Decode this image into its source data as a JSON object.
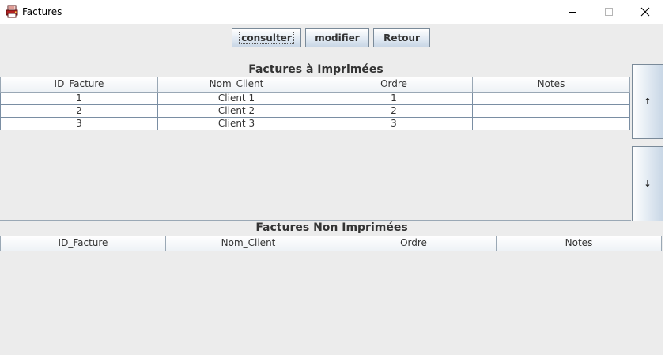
{
  "window": {
    "title": "Factures",
    "icon": "printer-app-icon",
    "controls": {
      "minimize": "minimize-icon",
      "maximize": "maximize-icon",
      "close": "close-icon"
    }
  },
  "toolbar": {
    "consulter_label": "consulter",
    "modifier_label": "modifier",
    "retour_label": "Retour"
  },
  "printed_table": {
    "title": "Factures à Imprimées",
    "columns": [
      "ID_Facture",
      "Nom_Client",
      "Ordre",
      "Notes"
    ],
    "rows": [
      [
        "1",
        "Client 1",
        "1",
        ""
      ],
      [
        "2",
        "Client 2",
        "2",
        ""
      ],
      [
        "3",
        "Client 3",
        "3",
        ""
      ]
    ]
  },
  "side_buttons": {
    "up_label": "↑",
    "down_label": "↓"
  },
  "unprinted_table": {
    "title": "Factures Non Imprimées",
    "columns": [
      "ID_Facture",
      "Nom_Client",
      "Ordre",
      "Notes"
    ],
    "rows": []
  },
  "colors": {
    "window_bg": "#ececec",
    "button_border": "#7a8a99",
    "grid_border": "#7a8ea3"
  }
}
